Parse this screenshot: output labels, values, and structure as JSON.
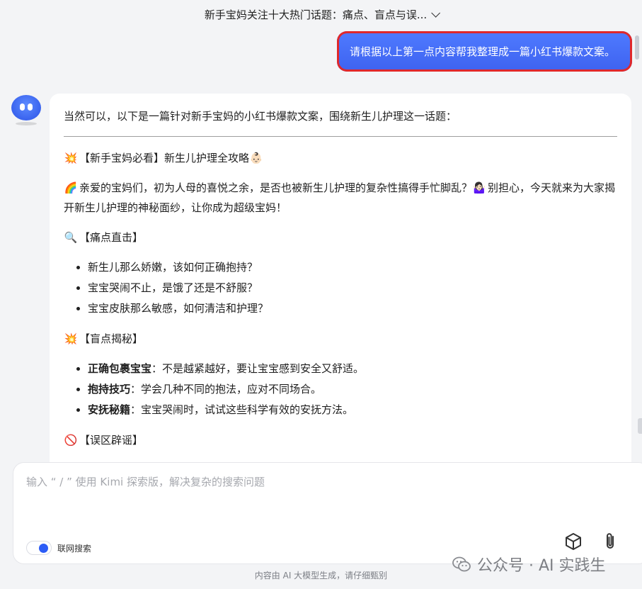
{
  "header": {
    "title": "新手宝妈关注十大热门话题：痛点、盲点与误..."
  },
  "user_message": "请根据以上第一点内容帮我整理成一篇小红书爆款文案。",
  "assistant": {
    "intro": "当然可以，以下是一篇针对新手宝妈的小红书爆款文案，围绕新生儿护理这一话题：",
    "headline": {
      "emoji": "💥",
      "text": "【新手宝妈必看】新生儿护理全攻略",
      "emoji_end": "👶🏻"
    },
    "opening": {
      "emoji": "🌈",
      "text_a": "亲爱的宝妈们，初为人母的喜悦之余，是否也被新生儿护理的复杂性搞得手忙脚乱？",
      "emoji_mid": "🤷🏻‍♀️",
      "text_b": "别担心，今天就来为大家揭开新生儿护理的神秘面纱，让你成为超级宝妈！"
    },
    "pain": {
      "emoji": "🔍",
      "title": "【痛点直击】",
      "items": [
        "新生儿那么娇嫩，该如何正确抱持？",
        "宝宝哭闹不止，是饿了还是不舒服？",
        "宝宝皮肤那么敏感，如何清洁和护理？"
      ]
    },
    "blind": {
      "emoji": "💥",
      "title": "【盲点揭秘】",
      "items": [
        {
          "bold": "正确包裹宝宝",
          "text": "：不是越紧越好，要让宝宝感到安全又舒适。"
        },
        {
          "bold": "抱持技巧",
          "text": "：学会几种不同的抱法，应对不同场合。"
        },
        {
          "bold": "安抚秘籍",
          "text": "：宝宝哭闹时，试试这些科学有效的安抚方法。"
        }
      ]
    },
    "myth": {
      "emoji": "🚫",
      "title": "【误区辟谣】"
    }
  },
  "input": {
    "placeholder": "输入 “ / ” 使用 Kimi 探索版，解决复杂的搜索问题",
    "web_search_label": "联网搜索",
    "web_search_on": true
  },
  "watermark": "公众号 · AI 实践生",
  "disclaimer": "内容由 AI 大模型生成，请仔细甄别",
  "icons": {
    "cube": "cube-icon",
    "clip": "paperclip-icon",
    "wechat": "wechat-icon"
  },
  "colors": {
    "accent": "#2c5cf6",
    "user_bubble": "#4469f4",
    "highlight_border": "#e0282b"
  }
}
